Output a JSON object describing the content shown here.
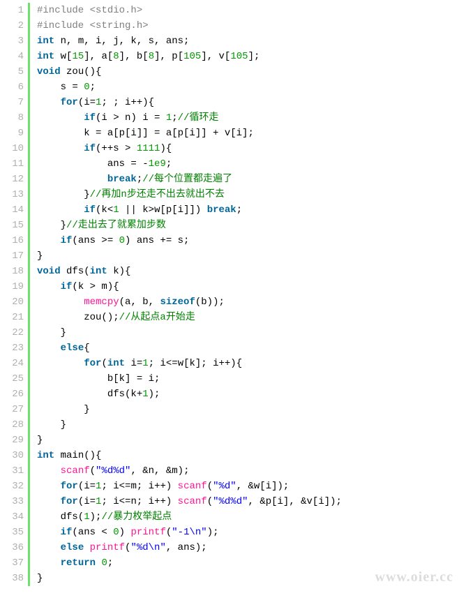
{
  "watermark": "www.oier.cc",
  "lines": [
    {
      "n": "1",
      "html": "<span class='pp'>#include &lt;stdio.h&gt;</span>"
    },
    {
      "n": "2",
      "html": "<span class='pp'>#include &lt;string.h&gt;</span>"
    },
    {
      "n": "3",
      "html": "<span class='kw'>int</span> n, m, i, j, k, s, ans;"
    },
    {
      "n": "4",
      "html": "<span class='kw'>int</span> w[<span class='num'>15</span>], a[<span class='num'>8</span>], b[<span class='num'>8</span>], p[<span class='num'>105</span>], v[<span class='num'>105</span>];"
    },
    {
      "n": "5",
      "html": "<span class='kw'>void</span> zou(){"
    },
    {
      "n": "6",
      "html": "    s = <span class='num'>0</span>;"
    },
    {
      "n": "7",
      "html": "    <span class='kw'>for</span>(i=<span class='num'>1</span>; ; i++){"
    },
    {
      "n": "8",
      "html": "        <span class='kw'>if</span>(i &gt; n) i = <span class='num'>1</span>;<span class='com'>//循环走</span>"
    },
    {
      "n": "9",
      "html": "        k = a[p[i]] = a[p[i]] + v[i];"
    },
    {
      "n": "10",
      "html": "        <span class='kw'>if</span>(++s &gt; <span class='num'>1111</span>){"
    },
    {
      "n": "11",
      "html": "            ans = -<span class='num'>1e9</span>;"
    },
    {
      "n": "12",
      "html": "            <span class='kw'>break</span>;<span class='com'>//每个位置都走遍了</span>"
    },
    {
      "n": "13",
      "html": "        }<span class='com'>//再加n步还走不出去就出不去</span>"
    },
    {
      "n": "14",
      "html": "        <span class='kw'>if</span>(k&lt;<span class='num'>1</span> || k&gt;w[p[i]]) <span class='kw'>break</span>;"
    },
    {
      "n": "15",
      "html": "    }<span class='com'>//走出去了就累加步数</span>"
    },
    {
      "n": "16",
      "html": "    <span class='kw'>if</span>(ans &gt;= <span class='num'>0</span>) ans += s;"
    },
    {
      "n": "17",
      "html": "}"
    },
    {
      "n": "18",
      "html": "<span class='kw'>void</span> dfs(<span class='kw'>int</span> k){"
    },
    {
      "n": "19",
      "html": "    <span class='kw'>if</span>(k &gt; m){"
    },
    {
      "n": "20",
      "html": "        <span class='fn'>memcpy</span>(a, b, <span class='kw'>sizeof</span>(b));"
    },
    {
      "n": "21",
      "html": "        zou();<span class='com'>//从起点a开始走</span>"
    },
    {
      "n": "22",
      "html": "    }"
    },
    {
      "n": "23",
      "html": "    <span class='kw'>else</span>{"
    },
    {
      "n": "24",
      "html": "        <span class='kw'>for</span>(<span class='kw'>int</span> i=<span class='num'>1</span>; i&lt;=w[k]; i++){"
    },
    {
      "n": "25",
      "html": "            b[k] = i;"
    },
    {
      "n": "26",
      "html": "            dfs(k+<span class='num'>1</span>);"
    },
    {
      "n": "27",
      "html": "        }"
    },
    {
      "n": "28",
      "html": "    }"
    },
    {
      "n": "29",
      "html": "}"
    },
    {
      "n": "30",
      "html": "<span class='kw'>int</span> main(){"
    },
    {
      "n": "31",
      "html": "    <span class='fn'>scanf</span>(<span class='str'>\"%d%d\"</span>, &amp;n, &amp;m);"
    },
    {
      "n": "32",
      "html": "    <span class='kw'>for</span>(i=<span class='num'>1</span>; i&lt;=m; i++) <span class='fn'>scanf</span>(<span class='str'>\"%d\"</span>, &amp;w[i]);"
    },
    {
      "n": "33",
      "html": "    <span class='kw'>for</span>(i=<span class='num'>1</span>; i&lt;=n; i++) <span class='fn'>scanf</span>(<span class='str'>\"%d%d\"</span>, &amp;p[i], &amp;v[i]);"
    },
    {
      "n": "34",
      "html": "    dfs(<span class='num'>1</span>);<span class='com'>//暴力枚举起点</span>"
    },
    {
      "n": "35",
      "html": "    <span class='kw'>if</span>(ans &lt; <span class='num'>0</span>) <span class='fn'>printf</span>(<span class='str'>\"-1\\n\"</span>);"
    },
    {
      "n": "36",
      "html": "    <span class='kw'>else</span> <span class='fn'>printf</span>(<span class='str'>\"%d\\n\"</span>, ans);"
    },
    {
      "n": "37",
      "html": "    <span class='kw'>return</span> <span class='num'>0</span>;"
    },
    {
      "n": "38",
      "html": "}"
    }
  ]
}
